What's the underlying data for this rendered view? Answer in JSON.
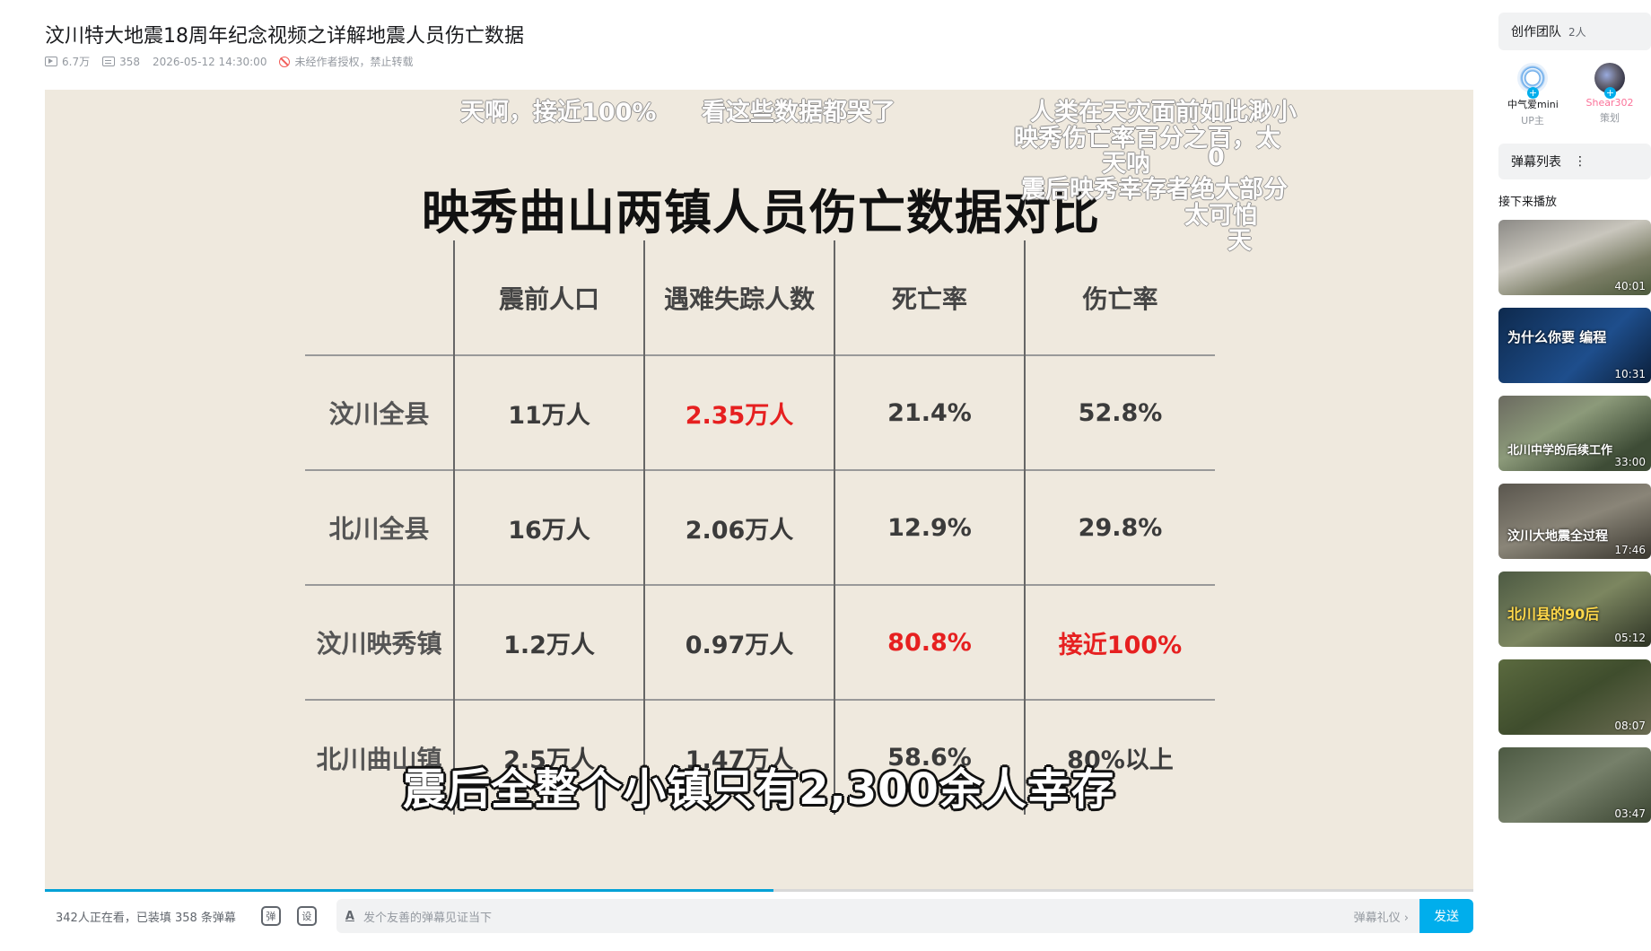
{
  "video": {
    "title": "汶川特大地震18周年纪念视频之详解地震人员伤亡数据",
    "views": "6.7万",
    "danmaku_count": "358",
    "publish_time": "2026-05-12 14:30:00",
    "copyright_notice": "未经作者授权，禁止转载"
  },
  "slide": {
    "title": "映秀曲山两镇人员伤亡数据对比",
    "headers": [
      "",
      "震前人口",
      "遇难失踪人数",
      "死亡率",
      "伤亡率"
    ],
    "rows": [
      [
        "汶川全县",
        "11万人",
        "2.35万人",
        "21.4%",
        "52.8%"
      ],
      [
        "北川全县",
        "16万人",
        "2.06万人",
        "12.9%",
        "29.8%"
      ],
      [
        "汶川映秀镇",
        "1.2万人",
        "0.97万人",
        "80.8%",
        "接近100%"
      ],
      [
        "北川曲山镇",
        "2.5万人",
        "1.47万人",
        "58.6%",
        "80%以上"
      ]
    ],
    "subtitle": "震后全整个小镇只有2,300余人幸存"
  },
  "danmaku": [
    "天啊，接近100%",
    "看这些数据都哭了",
    "人类在天灾面前如此渺小",
    "映秀伤亡率百分之百，太",
    "天呐",
    "0",
    "震后映秀幸存者绝大部分",
    "太可怕",
    "天"
  ],
  "player_bar": {
    "viewers_text": "342人正在看，已装填 358 条弹幕",
    "danmaku_toggle_icon": "弹",
    "settings_icon": "设",
    "input_prefix": "A",
    "input_placeholder": "发个友善的弹幕见证当下",
    "etiquette_link": "弹幕礼仪 ›",
    "send_label": "发送",
    "progress": 0.51
  },
  "sidebar": {
    "crew_label": "创作团队",
    "crew_count": "2人",
    "members": [
      {
        "name": "中气爱mini",
        "role": "UP主"
      },
      {
        "name": "Shear302",
        "role": "策划"
      }
    ],
    "danmaku_list_label": "弹幕列表",
    "danmaku_list_more": "⋮",
    "up_next_label": "接下来播放",
    "thumbnails": [
      {
        "duration": "40:01",
        "caption": ""
      },
      {
        "duration": "10:31",
        "caption": "为什么你要 编程"
      },
      {
        "duration": "33:00",
        "caption": "北川中学的后续工作"
      },
      {
        "duration": "17:46",
        "caption": "汶川大地震全过程"
      },
      {
        "duration": "05:12",
        "caption": "北川县的90后"
      },
      {
        "duration": "08:07",
        "caption": ""
      },
      {
        "duration": "03:47",
        "caption": ""
      }
    ]
  }
}
